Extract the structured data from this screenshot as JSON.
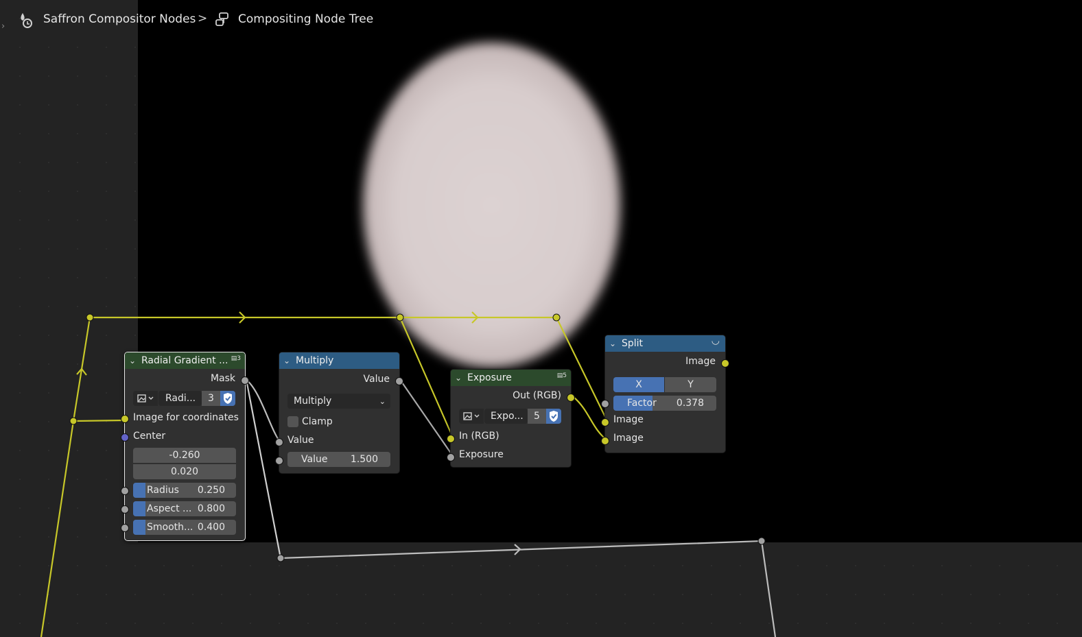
{
  "breadcrumb": {
    "file": "Saffron Compositor Nodes",
    "separator": ">",
    "tree": "Compositing Node Tree"
  },
  "colors": {
    "socket_color": "#c7c729",
    "socket_float": "#a1a1a1",
    "socket_vector": "#6363c7",
    "accent": "#4772b3",
    "header_green": "#2c4a2c",
    "header_blue": "#2d5c83"
  },
  "nodes": {
    "radial": {
      "title": "Radial Gradient ...",
      "users": "3",
      "output": "Mask",
      "datablock_name": "Radi...",
      "datablock_users": "3",
      "input_image": "Image for coordinates",
      "center_label": "Center",
      "center_x": "-0.260",
      "center_y": "0.020",
      "radius_label": "Radius",
      "radius_value": "0.250",
      "radius_fill": 0.12,
      "aspect_label": "Aspect ...",
      "aspect_value": "0.800",
      "aspect_fill": 0.12,
      "smooth_label": "Smooth...",
      "smooth_value": "0.400",
      "smooth_fill": 0.12
    },
    "multiply": {
      "title": "Multiply",
      "output": "Value",
      "operation": "Multiply",
      "clamp_label": "Clamp",
      "clamp_checked": false,
      "input1": "Value",
      "input2_label": "Value",
      "input2_value": "1.500"
    },
    "exposure": {
      "title": "Exposure",
      "users": "5",
      "output": "Out (RGB)",
      "datablock_name": "Expo...",
      "datablock_users": "5",
      "input_rgb": "In (RGB)",
      "input_exposure": "Exposure"
    },
    "split": {
      "title": "Split",
      "output": "Image",
      "axis_x": "X",
      "axis_y": "Y",
      "axis_selected": "X",
      "factor_label": "Factor",
      "factor_value": "0.378",
      "factor_fill": 0.378,
      "input1": "Image",
      "input2": "Image"
    }
  }
}
